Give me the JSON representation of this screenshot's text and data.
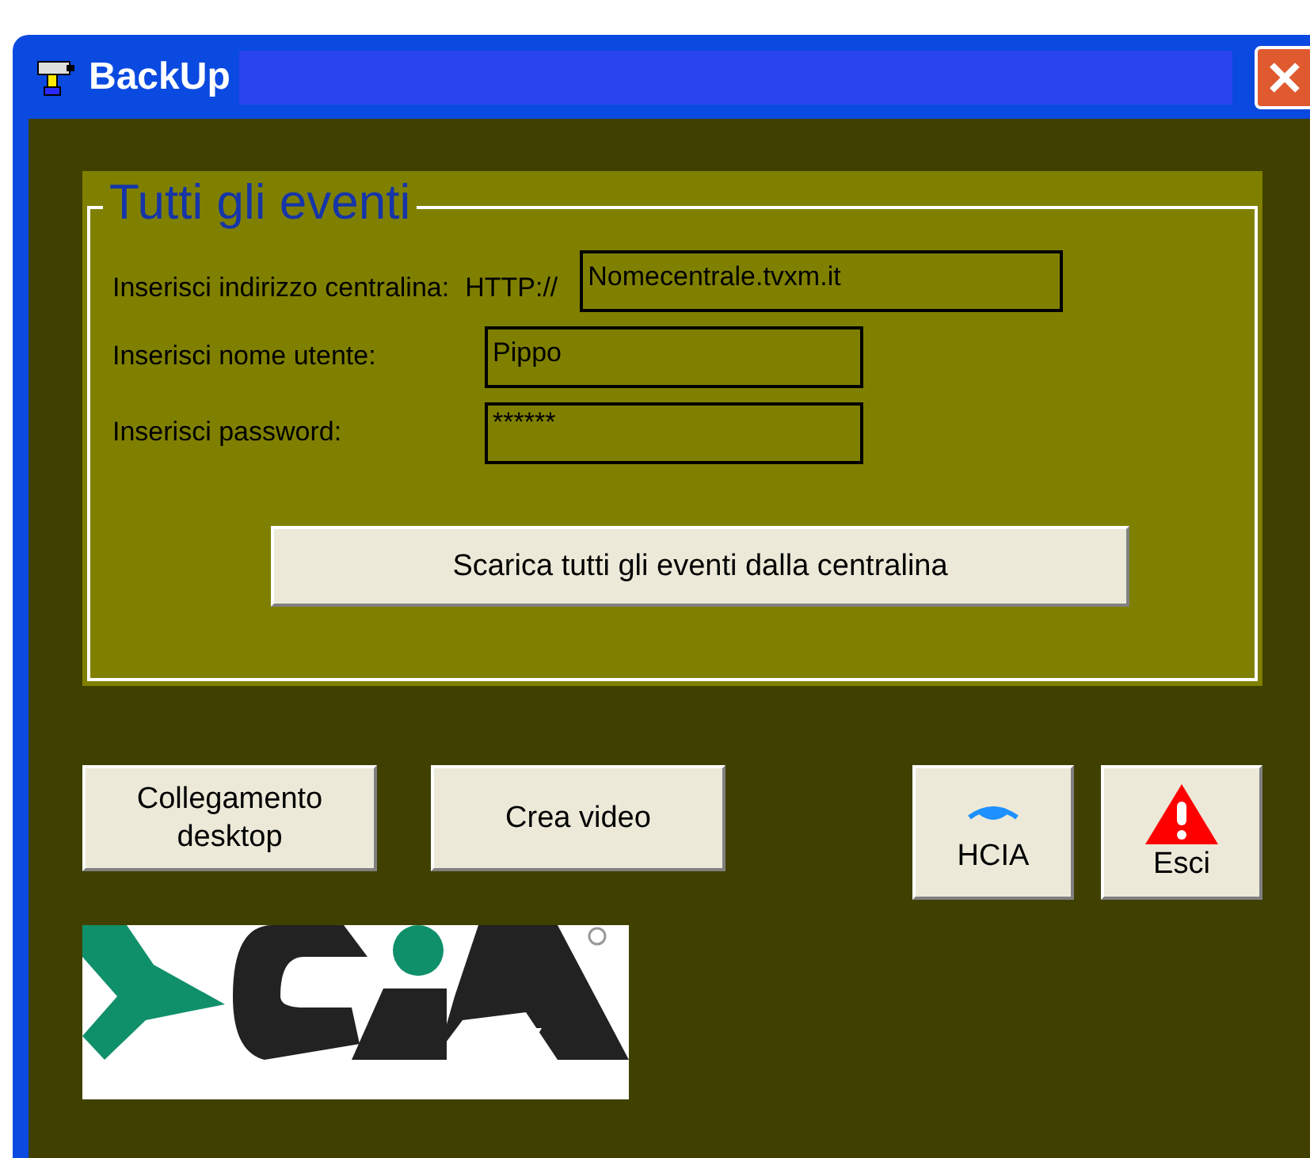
{
  "window": {
    "title": "BackUp"
  },
  "group": {
    "title": "Tutti gli eventi",
    "fields": [
      {
        "label": "Inserisci indirizzo centralina:",
        "prefix": "HTTP://",
        "value": "Nomecentrale.tvxm.it",
        "kind": "wide"
      },
      {
        "label": "Inserisci nome utente:",
        "value": "Pippo",
        "kind": "narrow"
      },
      {
        "label": "Inserisci password:",
        "value": "******",
        "kind": "narrow"
      }
    ],
    "download_button": "Scarica tutti gli eventi dalla centralina"
  },
  "buttons": [
    {
      "label": "Collegamento desktop",
      "kind": "text"
    },
    {
      "label": "Crea video",
      "kind": "text"
    },
    {
      "label": "HCIA",
      "kind": "eye"
    },
    {
      "label": "Esci",
      "kind": "warning"
    }
  ]
}
